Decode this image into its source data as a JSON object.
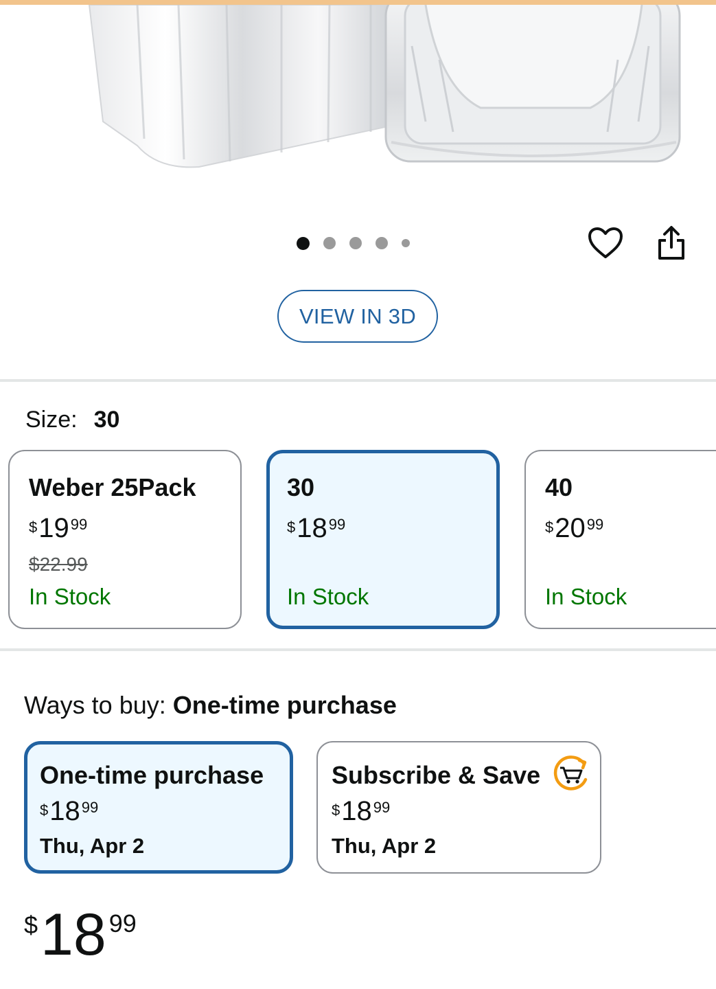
{
  "colors": {
    "accent_blue": "#2162a1",
    "selected_bg": "#edf8ff",
    "in_stock_green": "#007600",
    "top_strip": "#f2c48c"
  },
  "gallery": {
    "image_alt": "Aluminum foil pans product photo",
    "dot_count": 5,
    "active_dot": 1,
    "wishlist_icon": "heart-icon",
    "share_icon": "share-icon"
  },
  "view_in_3d_label": "VIEW IN 3D",
  "size": {
    "label": "Size:",
    "selected_value": "30",
    "options": [
      {
        "name": "Weber 25Pack",
        "price_symbol": "$",
        "price_whole": "19",
        "price_fraction": "99",
        "list_price": "$22.99",
        "availability": "In Stock"
      },
      {
        "name": "30",
        "price_symbol": "$",
        "price_whole": "18",
        "price_fraction": "99",
        "list_price": "",
        "availability": "In Stock"
      },
      {
        "name": "40",
        "price_symbol": "$",
        "price_whole": "20",
        "price_fraction": "99",
        "list_price": "",
        "availability": "In Stock"
      }
    ]
  },
  "ways_to_buy": {
    "label": "Ways to buy:",
    "selected_value": "One-time purchase",
    "options": [
      {
        "title": "One-time purchase",
        "price_symbol": "$",
        "price_whole": "18",
        "price_fraction": "99",
        "delivery_date": "Thu, Apr 2"
      },
      {
        "title": "Subscribe & Save",
        "icon": "subscribe-cart-icon",
        "price_symbol": "$",
        "price_whole": "18",
        "price_fraction": "99",
        "delivery_date": "Thu, Apr 2"
      }
    ]
  },
  "final_price": {
    "symbol": "$",
    "whole": "18",
    "fraction": "99"
  }
}
